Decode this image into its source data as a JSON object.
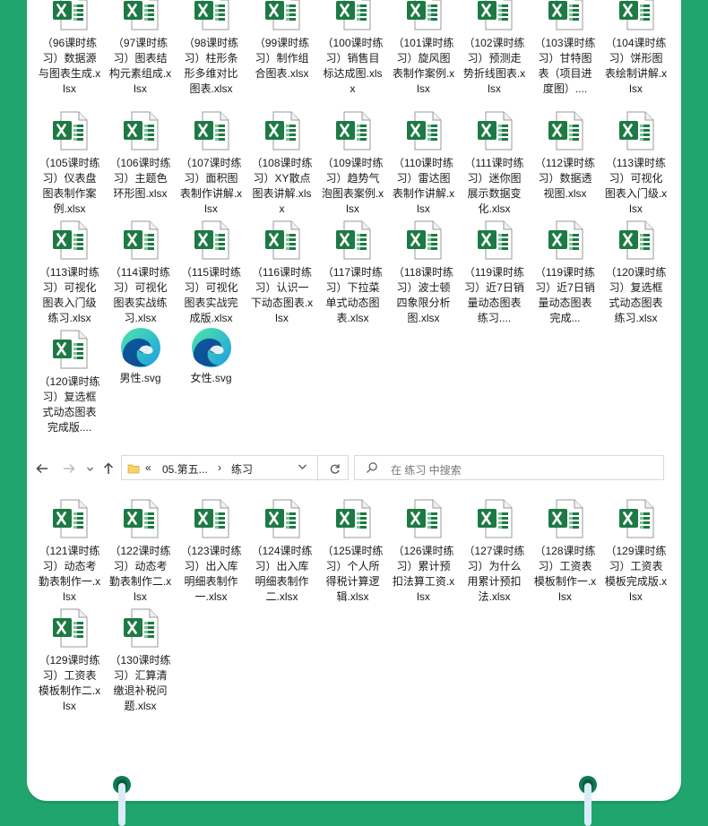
{
  "section1": {
    "files": [
      {
        "name": "（96课时练习）数据源与图表生成.xlsx",
        "type": "xlsx"
      },
      {
        "name": "（97课时练习）图表结构元素组成.xlsx",
        "type": "xlsx"
      },
      {
        "name": "（98课时练习）柱形条形多维对比图表.xlsx",
        "type": "xlsx"
      },
      {
        "name": "（99课时练习）制作组合图表.xlsx",
        "type": "xlsx"
      },
      {
        "name": "（100课时练习）销售目标达成图.xlsx",
        "type": "xlsx"
      },
      {
        "name": "（101课时练习）旋风图表制作案例.xlsx",
        "type": "xlsx"
      },
      {
        "name": "（102课时练习）预测走势折线图表.xlsx",
        "type": "xlsx"
      },
      {
        "name": "（103课时练习）甘特图表（项目进度图）....",
        "type": "xlsx"
      },
      {
        "name": "（104课时练习）饼形图表绘制讲解.xlsx",
        "type": "xlsx"
      },
      {
        "name": "（105课时练习）仪表盘图表制作案例.xlsx",
        "type": "xlsx"
      },
      {
        "name": "（106课时练习）主题色环形图.xlsx",
        "type": "xlsx"
      },
      {
        "name": "（107课时练习）面积图表制作讲解.xlsx",
        "type": "xlsx"
      },
      {
        "name": "（108课时练习）XY散点图表讲解.xlsx",
        "type": "xlsx"
      },
      {
        "name": "（109课时练习）趋势气泡图表案例.xlsx",
        "type": "xlsx"
      },
      {
        "name": "（110课时练习）雷达图表制作讲解.xlsx",
        "type": "xlsx"
      },
      {
        "name": "（111课时练习）迷你图展示数据变化.xlsx",
        "type": "xlsx"
      },
      {
        "name": "（112课时练习）数据透视图.xlsx",
        "type": "xlsx"
      },
      {
        "name": "（113课时练习）可视化图表入门级.xlsx",
        "type": "xlsx"
      },
      {
        "name": "（113课时练习）可视化图表入门级练习.xlsx",
        "type": "xlsx"
      },
      {
        "name": "（114课时练习）可视化图表实战练习.xlsx",
        "type": "xlsx"
      },
      {
        "name": "（115课时练习）可视化图表实战完成版.xlsx",
        "type": "xlsx"
      },
      {
        "name": "（116课时练习）认识一下动态图表.xlsx",
        "type": "xlsx"
      },
      {
        "name": "（117课时练习）下拉菜单式动态图表.xlsx",
        "type": "xlsx"
      },
      {
        "name": "（118课时练习）波士顿四象限分析图.xlsx",
        "type": "xlsx"
      },
      {
        "name": "（119课时练习）近7日销量动态图表练习....",
        "type": "xlsx"
      },
      {
        "name": "（119课时练习）近7日销量动态图表完成...",
        "type": "xlsx"
      },
      {
        "name": "（120课时练习）复选框式动态图表练习.xlsx",
        "type": "xlsx"
      },
      {
        "name": "（120课时练习）复选框式动态图表完成版....",
        "type": "xlsx"
      },
      {
        "name": "男性.svg",
        "type": "svg"
      },
      {
        "name": "女性.svg",
        "type": "svg"
      }
    ]
  },
  "toolbar": {
    "back_icon": "arrow-left-icon",
    "forward_icon": "arrow-right-icon",
    "recent_icon": "chevron-down-icon",
    "up_icon": "arrow-up-icon",
    "crumb_overflow": "«",
    "crumb_parent": "05.第五...",
    "crumb_sep": "›",
    "crumb_current": "练习",
    "dropdown_icon": "chevron-down-icon",
    "refresh_icon": "refresh-icon",
    "search_placeholder": "在 练习 中搜索"
  },
  "section2": {
    "files": [
      {
        "name": "（121课时练习）动态考勤表制作一.xlsx",
        "type": "xlsx"
      },
      {
        "name": "（122课时练习）动态考勤表制作二.xlsx",
        "type": "xlsx"
      },
      {
        "name": "（123课时练习）出入库明细表制作一.xlsx",
        "type": "xlsx"
      },
      {
        "name": "（124课时练习）出入库明细表制作二.xlsx",
        "type": "xlsx"
      },
      {
        "name": "（125课时练习）个人所得税计算逻辑.xlsx",
        "type": "xlsx"
      },
      {
        "name": "（126课时练习）累计预扣法算工资.xlsx",
        "type": "xlsx"
      },
      {
        "name": "（127课时练习）为什么用累计预扣法.xlsx",
        "type": "xlsx"
      },
      {
        "name": "（128课时练习）工资表模板制作一.xlsx",
        "type": "xlsx"
      },
      {
        "name": "（129课时练习）工资表模板完成版.xlsx",
        "type": "xlsx"
      },
      {
        "name": "（129课时练习）工资表模板制作二.xlsx",
        "type": "xlsx"
      },
      {
        "name": "（130课时练习）汇算清缴退补税问题.xlsx",
        "type": "xlsx"
      }
    ]
  },
  "colors": {
    "background": "#1fa56d",
    "excel_green": "#1d7a44",
    "ring": "#d9ecf7"
  }
}
